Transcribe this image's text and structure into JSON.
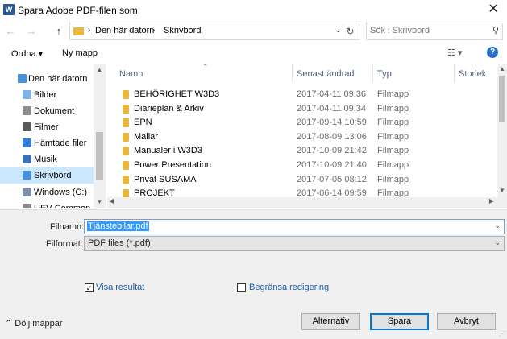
{
  "window": {
    "app_icon": "W",
    "title": "Spara Adobe PDF-filen som",
    "close_glyph": "✕"
  },
  "address": {
    "back": "←",
    "forward": "→",
    "up": "↑",
    "breadcrumbs": [
      "Den här datorn",
      "Skrivbord"
    ],
    "separator": "›",
    "dropdown": "⌄",
    "refresh": "↻",
    "search_placeholder": "Sök i Skrivbord",
    "search_icon": "⚲"
  },
  "toolbar": {
    "organize": "Ordna ▾",
    "new_folder": "Ny mapp",
    "view": "☷ ▾",
    "help": "?"
  },
  "nav": {
    "items": [
      {
        "label": "Den här datorn",
        "icon": "computer-icon",
        "color": "#4a90d9"
      },
      {
        "label": "Bilder",
        "icon": "pictures-icon",
        "color": "#7fb3e6"
      },
      {
        "label": "Dokument",
        "icon": "documents-icon",
        "color": "#8c8c8c"
      },
      {
        "label": "Filmer",
        "icon": "videos-icon",
        "color": "#5a5a5a"
      },
      {
        "label": "Hämtade filer",
        "icon": "downloads-icon",
        "color": "#2f7ed8"
      },
      {
        "label": "Musik",
        "icon": "music-icon",
        "color": "#3b6fb6"
      },
      {
        "label": "Skrivbord",
        "icon": "desktop-icon",
        "color": "#4a90d9"
      },
      {
        "label": "Windows (C:)",
        "icon": "drive-icon",
        "color": "#7a8fa6"
      },
      {
        "label": "UEV-Common (\\",
        "icon": "network-drive-icon",
        "color": "#8a8a8a"
      }
    ],
    "selected_index": 6,
    "scroll_up": "▲",
    "scroll_down": "▼"
  },
  "files": {
    "columns": [
      "Namn",
      "Senast ändrad",
      "Typ",
      "Storlek"
    ],
    "sort_indicator": "⌃",
    "rows": [
      {
        "name": "BEHÖRIGHET W3D3",
        "date": "2017-04-11 09:36",
        "type": "Filmapp"
      },
      {
        "name": "Diarieplan & Arkiv",
        "date": "2017-04-11 09:34",
        "type": "Filmapp"
      },
      {
        "name": "EPN",
        "date": "2017-09-14 10:59",
        "type": "Filmapp"
      },
      {
        "name": "Mallar",
        "date": "2017-08-09 13:06",
        "type": "Filmapp"
      },
      {
        "name": "Manualer i W3D3",
        "date": "2017-10-09 21:42",
        "type": "Filmapp"
      },
      {
        "name": "Power Presentation",
        "date": "2017-10-09 21:40",
        "type": "Filmapp"
      },
      {
        "name": "Privat SUSAMA",
        "date": "2017-07-05 08:12",
        "type": "Filmapp"
      },
      {
        "name": "PROJEKT",
        "date": "2017-06-14 09:59",
        "type": "Filmapp"
      }
    ],
    "scroll_up": "▲",
    "scroll_down": "▼",
    "scroll_left": "◀",
    "scroll_right": "▶"
  },
  "form": {
    "filename_label": "Filnamn:",
    "filename_value": "Tjänstebilar.pdf",
    "format_label": "Filformat:",
    "format_value": "PDF files (*.pdf)",
    "dropdown_glyph": "⌄",
    "show_result_label": "Visa resultat",
    "show_result_checked": "✓",
    "restrict_label": "Begränsa redigering",
    "hide_folders": "⌃ Dölj mappar",
    "options_button": "Alternativ",
    "save_button": "Spara",
    "cancel_button": "Avbryt"
  }
}
